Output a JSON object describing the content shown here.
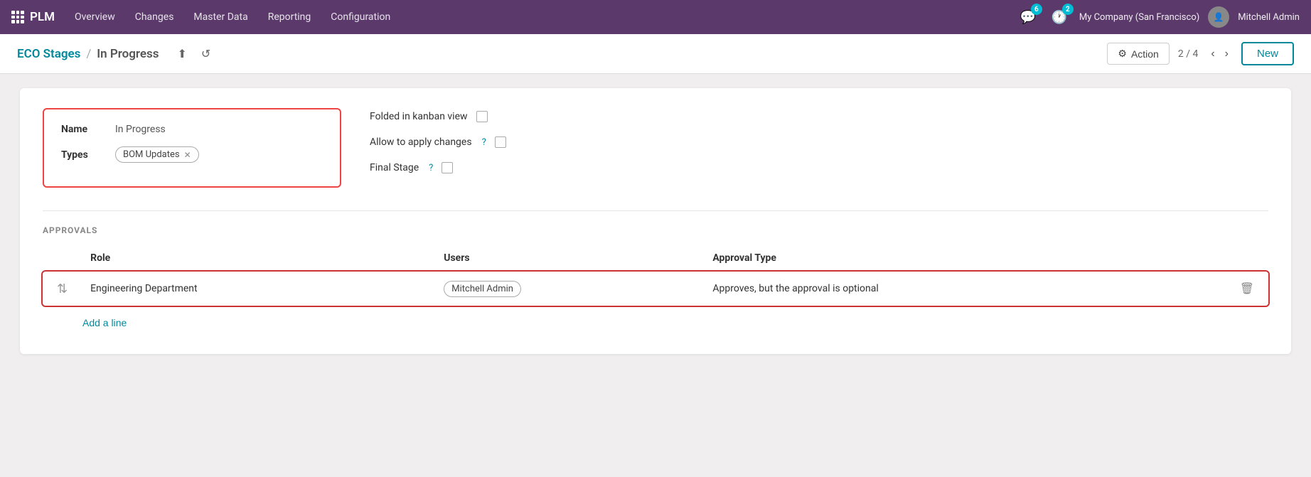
{
  "topnav": {
    "brand": "PLM",
    "menu_items": [
      "Overview",
      "Changes",
      "Master Data",
      "Reporting",
      "Configuration"
    ],
    "msg_count": "6",
    "activity_count": "2",
    "company": "My Company (San Francisco)",
    "username": "Mitchell Admin"
  },
  "subheader": {
    "breadcrumb_parent": "ECO Stages",
    "breadcrumb_sep": "/",
    "breadcrumb_current": "In Progress",
    "upload_icon": "↑",
    "undo_icon": "↺",
    "action_label": "Action",
    "nav_position": "2 / 4",
    "new_label": "New"
  },
  "form": {
    "name_label": "Name",
    "name_value": "In Progress",
    "types_label": "Types",
    "bom_updates_tag": "BOM Updates",
    "folded_label": "Folded in kanban view",
    "allow_label": "Allow to apply changes",
    "final_label": "Final Stage",
    "approvals_section_title": "APPROVALS",
    "table_cols": [
      "Role",
      "Users",
      "Approval Type"
    ],
    "approval_rows": [
      {
        "role": "Engineering Department",
        "users": "Mitchell Admin",
        "approval_type": "Approves, but the approval is optional"
      }
    ],
    "add_line_label": "Add a line"
  }
}
